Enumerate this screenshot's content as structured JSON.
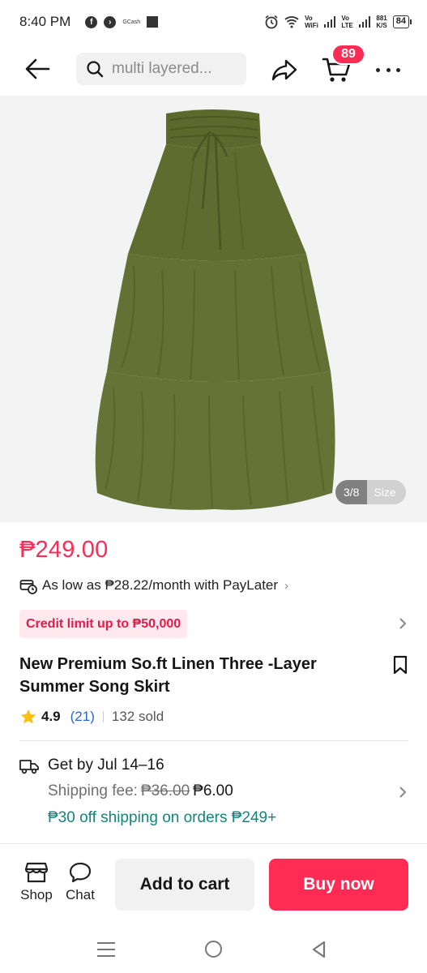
{
  "status_bar": {
    "time": "8:40 PM",
    "carrier_small": "GCash",
    "vo_wifi_top": "Vo",
    "vo_wifi_bottom": "WiFi",
    "vo_lte_top": "Vo",
    "vo_lte_bottom": "LTE",
    "speed_top": "881",
    "speed_bottom": "K/S",
    "battery": "84"
  },
  "header": {
    "search_placeholder": "multi layered...",
    "cart_count": "89"
  },
  "gallery": {
    "counter": "3/8",
    "size_label": "Size",
    "skirt_color": "#5f6b2f"
  },
  "product": {
    "price": "₱249.00",
    "paylater": "As low as ₱28.22/month with PayLater",
    "credit_limit": "Credit limit up to ₱50,000",
    "title": "New Premium So.ft Linen Three -Layer Summer Song Skirt",
    "rating": "4.9",
    "review_count": "(21)",
    "sold": "132 sold"
  },
  "shipping": {
    "delivery": "Get by Jul 14–16",
    "fee_label": "Shipping fee:",
    "fee_old": "₱36.00",
    "fee_new": "₱6.00",
    "promo": "₱30 off shipping on orders ₱249+"
  },
  "bottom_bar": {
    "shop_label": "Shop",
    "chat_label": "Chat",
    "add_to_cart": "Add to cart",
    "buy_now": "Buy now"
  },
  "colors": {
    "accent": "#fe2c55",
    "promo_green": "#13857b",
    "link_blue": "#2a64d8"
  }
}
